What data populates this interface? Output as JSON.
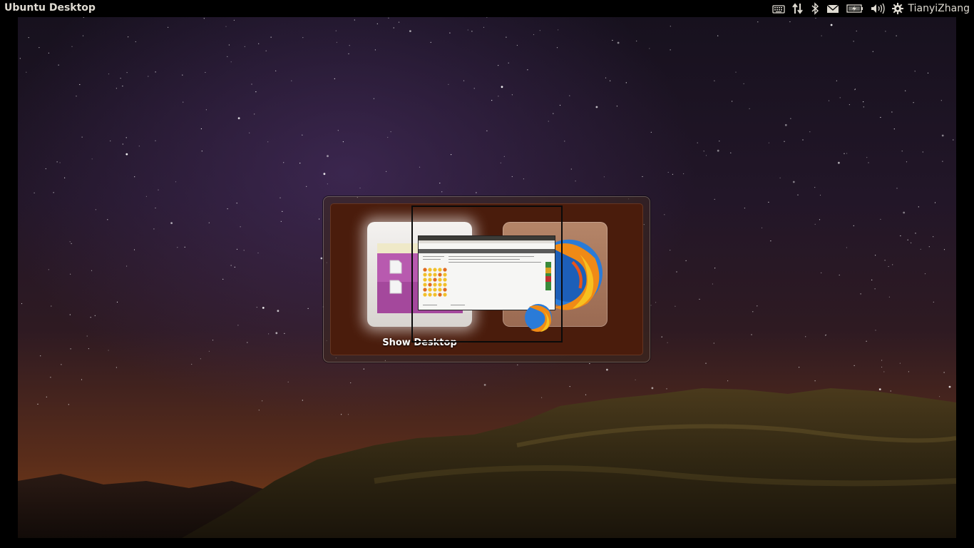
{
  "topbar": {
    "title": "Ubuntu Desktop",
    "user_name": "TianyiZhang",
    "indicators": [
      {
        "icon": "keyboard-icon"
      },
      {
        "icon": "network-updown-icon"
      },
      {
        "icon": "bluetooth-icon"
      },
      {
        "icon": "mail-icon"
      },
      {
        "icon": "battery-icon"
      },
      {
        "icon": "volume-icon"
      },
      {
        "icon": "gear-icon"
      }
    ]
  },
  "switcher": {
    "items": [
      {
        "label": "Show Desktop",
        "icon": "show-desktop-icon",
        "selected": true
      },
      {
        "label": "",
        "icon": "firefox-icon",
        "selected": false
      }
    ]
  },
  "colors": {
    "topbar_bg": "#000000",
    "topbar_text": "#dfdbd2",
    "switcher_bg": "#4a1c0c",
    "folder_purple": "#a4489c",
    "firefox_orange": "#f08a16",
    "firefox_blue": "#2a7bd8"
  }
}
